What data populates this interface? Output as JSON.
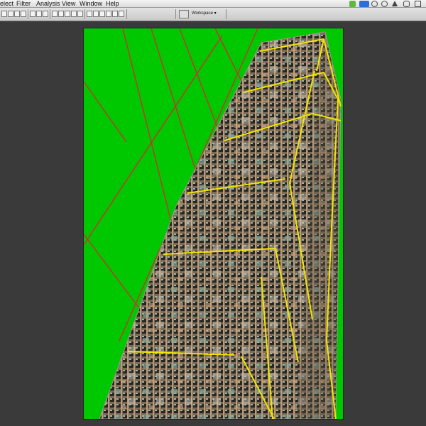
{
  "menubar": {
    "items": [
      "elect",
      "Filter",
      "Analysis",
      "View",
      "Window",
      "Help"
    ]
  },
  "toolbar": {
    "workspace_label": "Workspace ▾"
  },
  "colors": {
    "canvas_background": "#00c800",
    "grid_line": "#c0392b",
    "perspective_box": "#f2e400"
  }
}
